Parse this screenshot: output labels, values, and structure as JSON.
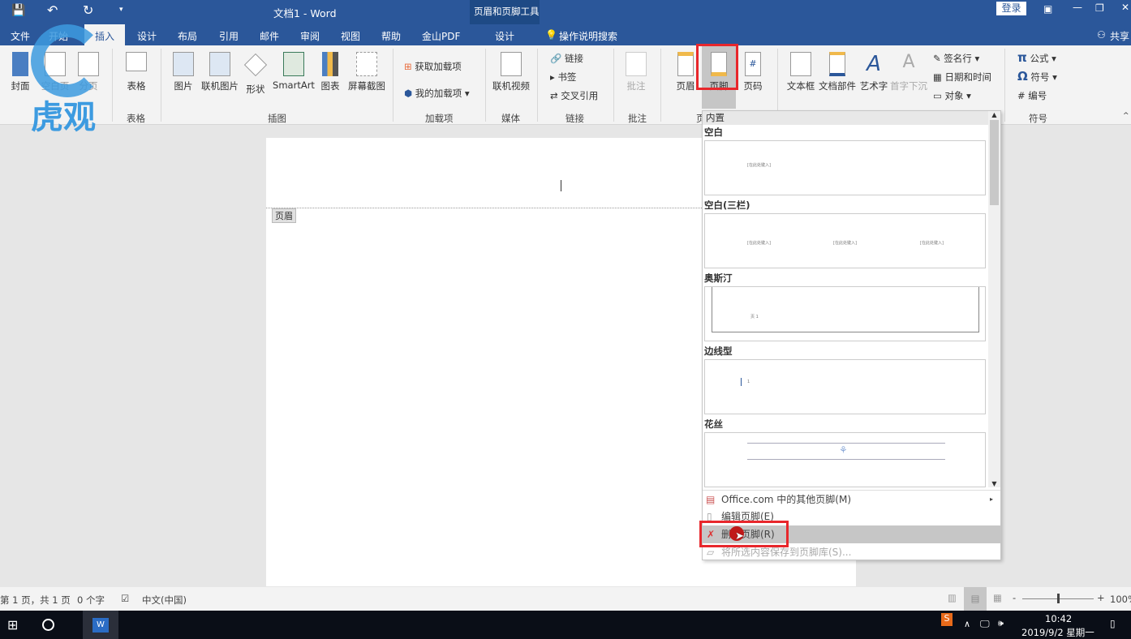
{
  "titlebar": {
    "title": "文档1  -  Word",
    "context_tool": "页眉和页脚工具",
    "login": "登录",
    "share": "共享"
  },
  "tabs": [
    "文件",
    "开始",
    "插入",
    "设计",
    "布局",
    "引用",
    "邮件",
    "审阅",
    "视图",
    "帮助",
    "金山PDF"
  ],
  "context_tab": "设计",
  "search": "操作说明搜索",
  "ribbon": {
    "pages": [
      "封面",
      "空白页",
      "分页"
    ],
    "table": "表格",
    "table_group": "表格",
    "illustrations": [
      "图片",
      "联机图片",
      "形状",
      "SmartArt",
      "图表",
      "屏幕截图"
    ],
    "illustrations_group": "插图",
    "addins": [
      "获取加载项",
      "我的加载项"
    ],
    "addins_group": "加载项",
    "media": "联机视频",
    "media_group": "媒体",
    "links": [
      "链接",
      "书签",
      "交叉引用"
    ],
    "links_group": "链接",
    "comment": "批注",
    "comment_group": "批注",
    "hf": [
      "页眉",
      "页脚",
      "页码"
    ],
    "hf_group": "页",
    "text": [
      "文本框",
      "文档部件",
      "艺术字",
      "首字下沉"
    ],
    "text_small": [
      "签名行",
      "日期和时间",
      "对象"
    ],
    "symbols": [
      "公式",
      "符号",
      "编号"
    ],
    "symbols_group": "符号"
  },
  "document": {
    "header_tag": "页眉"
  },
  "gallery": {
    "heading": "内置",
    "sections": [
      {
        "name": "空白",
        "placeholder": "[在此处键入]"
      },
      {
        "name": "空白(三栏)",
        "placeholders": [
          "[在此处键入]",
          "[在此处键入]",
          "[在此处键入]"
        ]
      },
      {
        "name": "奥斯汀",
        "text": "页 1"
      },
      {
        "name": "边线型",
        "text": "1"
      },
      {
        "name": "花丝"
      }
    ],
    "menu": [
      "Office.com 中的其他页脚(M)",
      "编辑页脚(E)",
      "删除页脚(R)",
      "将所选内容保存到页脚库(S)..."
    ]
  },
  "status": {
    "page": "第 1 页，共 1 页",
    "words": "0 个字",
    "lang": "中文(中国)",
    "zoom": "100%",
    "zoom_percent": 100
  },
  "taskbar": {
    "time": "10:42",
    "date": "2019/9/2 星期一"
  },
  "watermark": "虎观",
  "colors": {
    "word_blue": "#2b579a",
    "highlight": "#e8272c"
  }
}
